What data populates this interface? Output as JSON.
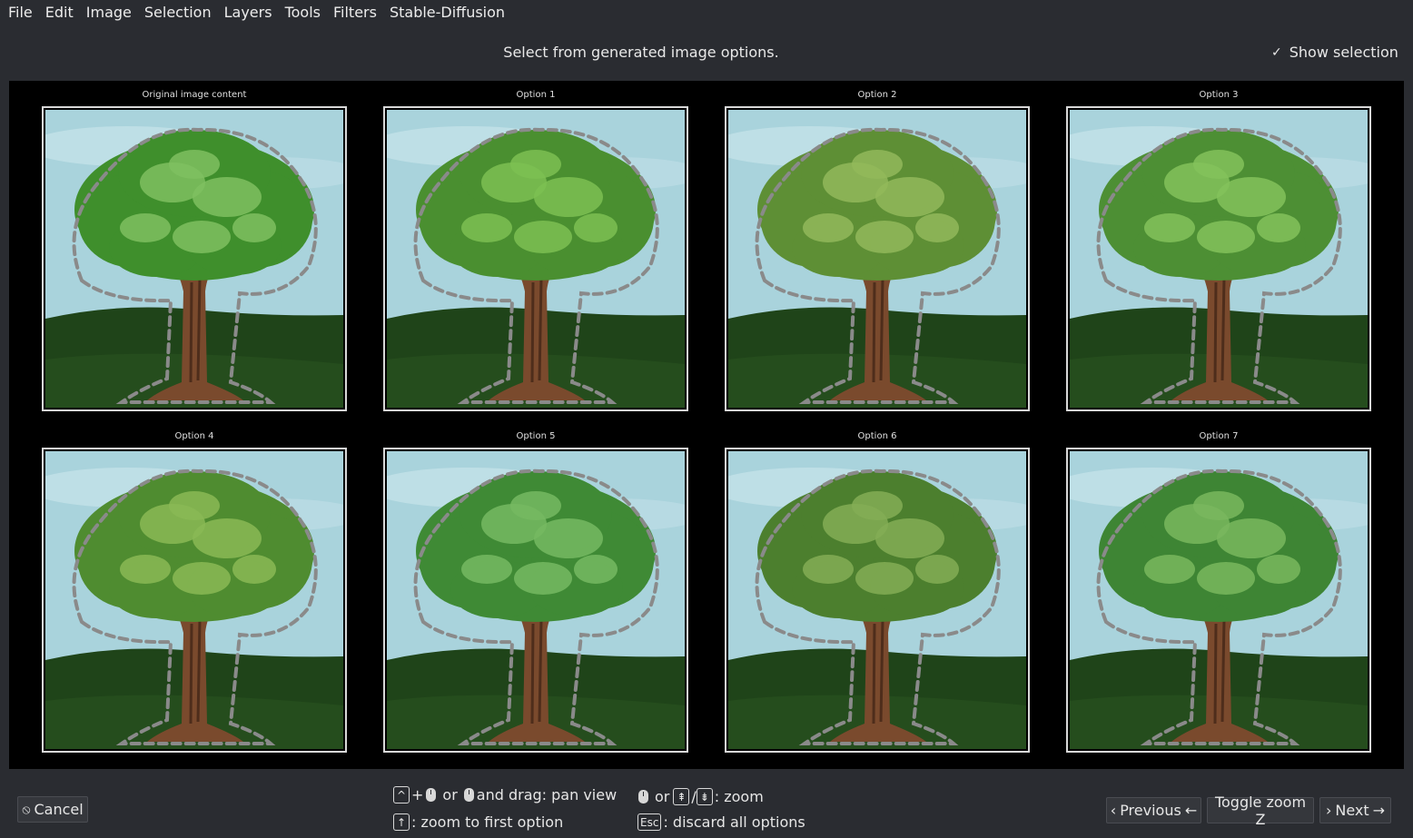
{
  "menu": [
    "File",
    "Edit",
    "Image",
    "Selection",
    "Layers",
    "Tools",
    "Filters",
    "Stable-Diffusion"
  ],
  "instruction": "Select from generated image options.",
  "show_selection": {
    "label": "Show selection",
    "checked": true
  },
  "options": [
    {
      "label": "Original image content",
      "canopy": "#3f8f2c",
      "highlight": "#7fc060"
    },
    {
      "label": "Option 1",
      "canopy": "#4a8f30",
      "highlight": "#7cbf52"
    },
    {
      "label": "Option 2",
      "canopy": "#5e8f35",
      "highlight": "#92b85a"
    },
    {
      "label": "Option 3",
      "canopy": "#4d8f34",
      "highlight": "#84c25c"
    },
    {
      "label": "Option 4",
      "canopy": "#4f8c30",
      "highlight": "#8ab955"
    },
    {
      "label": "Option 5",
      "canopy": "#3f8a35",
      "highlight": "#76b862"
    },
    {
      "label": "Option 6",
      "canopy": "#4c7f2e",
      "highlight": "#84ad55"
    },
    {
      "label": "Option 7",
      "canopy": "#3e8534",
      "highlight": "#79b75e"
    }
  ],
  "colors": {
    "sky": "#a9d3dc",
    "ground": "#1f4419",
    "trunk": "#7a4a2d",
    "selection": "#8a8a8a"
  },
  "bottom": {
    "cancel": "Cancel",
    "hints": {
      "pan_or": "or",
      "pan_text": "and drag: pan view",
      "first_text": ": zoom to first option",
      "zoom_or": "or",
      "zoom_sep": "/",
      "zoom_text": ": zoom",
      "esc_key": "Esc",
      "esc_text": ": discard all options"
    },
    "previous": "Previous",
    "toggle_zoom": "Toggle zoom Z",
    "next": "Next"
  }
}
